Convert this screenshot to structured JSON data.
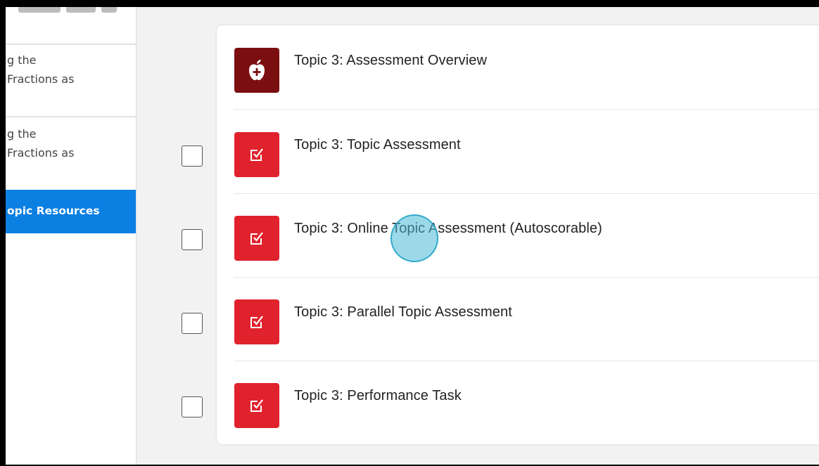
{
  "sidebar": {
    "items": [
      {
        "line1": "g the",
        "line2": "Fractions as"
      },
      {
        "line1": "g the",
        "line2": "Fractions as"
      },
      {
        "label": "opic Resources",
        "active": true
      }
    ]
  },
  "resources": [
    {
      "title": "Topic 3: Assessment Overview",
      "icon": "apple-plus-icon",
      "has_checkbox": false
    },
    {
      "title": "Topic 3: Topic Assessment",
      "icon": "checked-box-icon",
      "has_checkbox": true
    },
    {
      "title": "Topic 3: Online Topic Assessment (Autoscorable)",
      "icon": "checked-box-icon",
      "has_checkbox": true
    },
    {
      "title": "Topic 3: Parallel Topic Assessment",
      "icon": "checked-box-icon",
      "has_checkbox": true
    },
    {
      "title": "Topic 3: Performance Task",
      "icon": "checked-box-icon",
      "has_checkbox": true
    }
  ],
  "colors": {
    "active_sidebar": "#0c7fe3",
    "assessment_red": "#e0222d",
    "overview_maroon": "#7b0f10",
    "cursor_highlight": "#48b9d6"
  }
}
